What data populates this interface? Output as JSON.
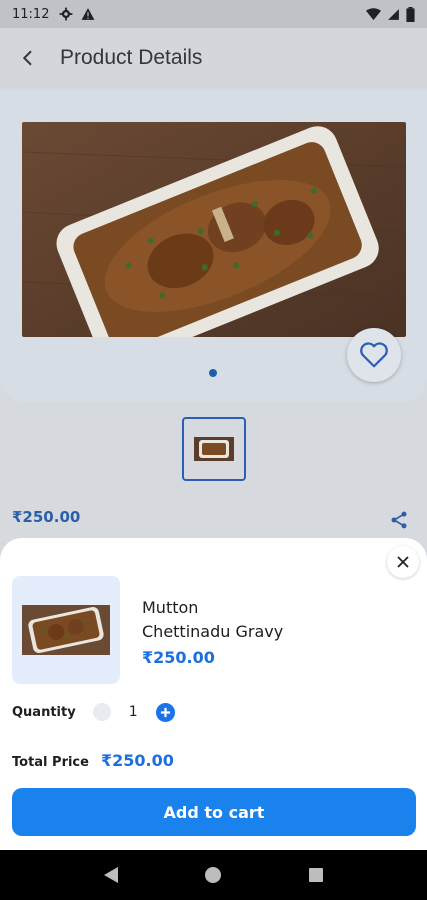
{
  "status": {
    "time": "11:12"
  },
  "appbar": {
    "title": "Product Details"
  },
  "product": {
    "price": "₹250.00",
    "name_line1": "Mutton",
    "name_line2": "Chettinadu Gravy",
    "sheet_price": "₹250.00"
  },
  "quantity": {
    "label": "Quantity",
    "value": "1"
  },
  "total": {
    "label": "Total Price",
    "value": "₹250.00"
  },
  "cart": {
    "button_label": "Add to cart"
  },
  "colors": {
    "accent": "#1a82ec",
    "price": "#1c6fe0"
  },
  "icons": [
    "settings-icon",
    "warning-icon",
    "wifi-icon",
    "signal-icon",
    "battery-icon",
    "back-arrow-icon",
    "heart-icon",
    "share-icon",
    "close-icon",
    "plus-icon",
    "nav-back-icon",
    "nav-home-icon",
    "nav-recents-icon"
  ]
}
